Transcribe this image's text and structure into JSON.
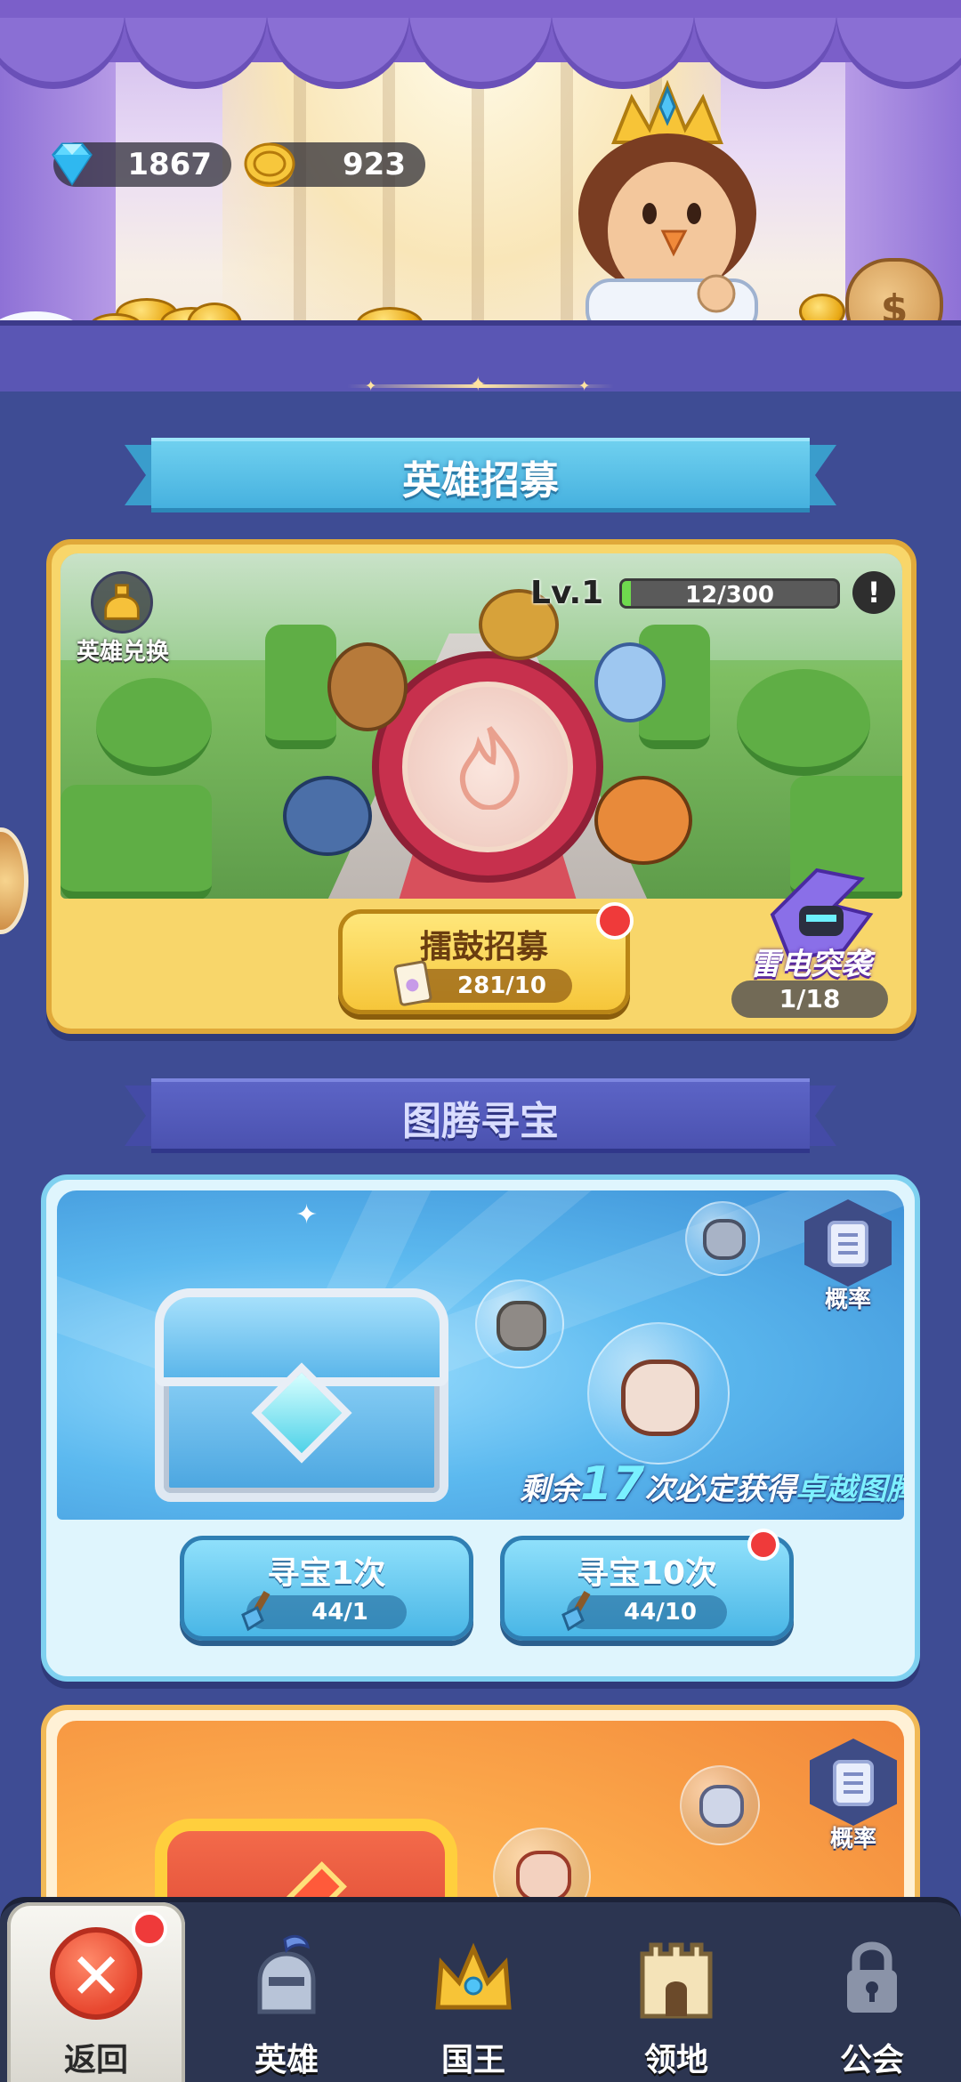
{
  "currency": {
    "gems": "1867",
    "gold": "923"
  },
  "hero_recruit": {
    "section_title": "英雄招募",
    "level_label": "Lv.1",
    "xp_text": "12/300",
    "xp_progress": 0.04,
    "alert_symbol": "!",
    "exchange_label": "英雄兑换",
    "drum_button": {
      "title": "擂鼓招募",
      "cost": "281/10"
    },
    "featured_label": "雷电突袭",
    "featured_count": "1/18"
  },
  "totem": {
    "section_title": "图腾寻宝",
    "probability_label": "概率",
    "guarantee_prefix": "剩余",
    "guarantee_number": "17",
    "guarantee_mid": "次必定获得",
    "guarantee_highlight": "卓越图腾",
    "seek_once": {
      "title": "寻宝1次",
      "cost": "44/1"
    },
    "seek_ten": {
      "title": "寻宝10次",
      "cost": "44/10"
    }
  },
  "gold_totem": {
    "probability_label": "概率"
  },
  "nav": {
    "back": "返回",
    "heroes": "英雄",
    "king": "国王",
    "territory": "领地",
    "guild": "公会"
  },
  "colors": {
    "background": "#3e4c94",
    "accent_blue": "#46b1df",
    "accent_gold": "#f6c63a",
    "badge_red": "#ef3a3a"
  },
  "icons": {
    "gem": "diamond-icon",
    "gold": "coin-icon",
    "exchange": "helmet-icon",
    "drum_cost": "scroll-icon",
    "seek_cost": "shovel-icon",
    "probability": "document-icon",
    "back": "close-icon",
    "heroes": "knight-helmet-icon",
    "king": "crown-icon",
    "territory": "castle-icon",
    "guild": "lock-icon"
  }
}
